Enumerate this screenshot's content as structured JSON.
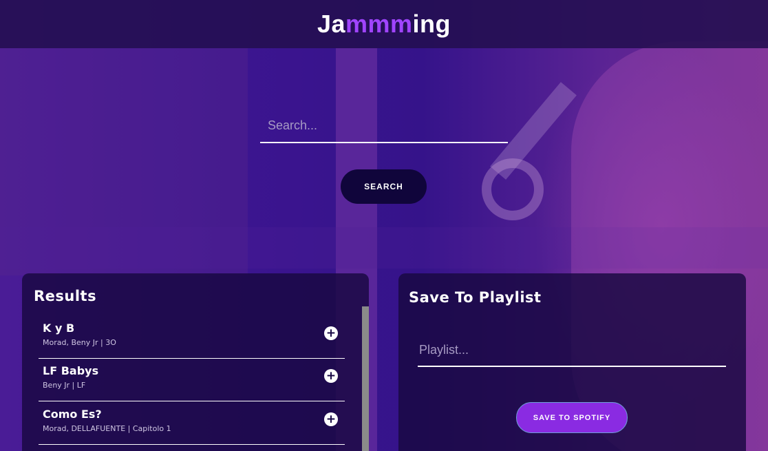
{
  "app": {
    "logo_prefix": "Ja",
    "logo_highlight": "mmm",
    "logo_suffix": "ing",
    "accent_color": "#a044ff"
  },
  "search": {
    "placeholder": "Search...",
    "value": "",
    "button_label": "SEARCH"
  },
  "results": {
    "title": "Results",
    "tracks": [
      {
        "title": "K y B",
        "info": "Morad, Beny Jr | 3O",
        "add_icon": "plus-circle-icon"
      },
      {
        "title": "LF Babys",
        "info": "Beny Jr | LF",
        "add_icon": "plus-circle-icon"
      },
      {
        "title": "Como Es?",
        "info": "Morad, DELLAFUENTE | Capitolo 1",
        "add_icon": "plus-circle-icon"
      }
    ]
  },
  "playlist": {
    "title": "Save To Playlist",
    "placeholder": "Playlist...",
    "value": "",
    "save_label": "SAVE TO SPOTIFY"
  }
}
